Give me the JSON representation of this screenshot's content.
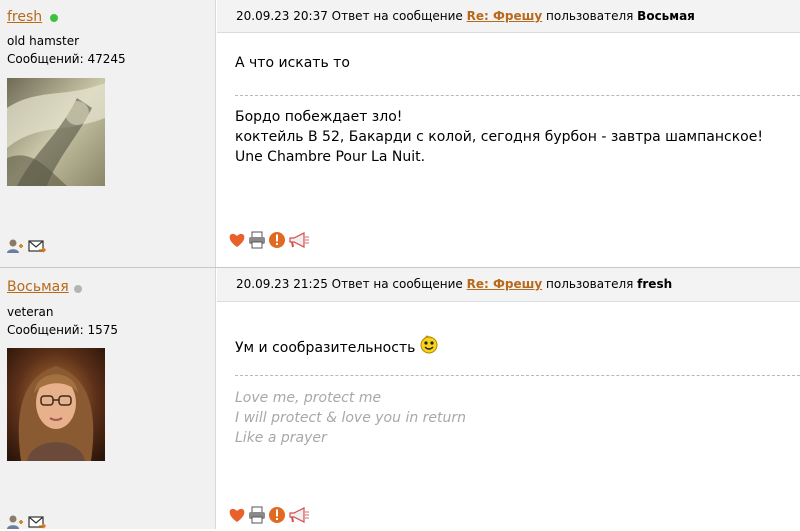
{
  "posts": [
    {
      "user": {
        "name": "fresh",
        "online": true,
        "rank": "old hamster",
        "posts": "Сообщений: 47245"
      },
      "header": {
        "datetime": "20.09.23 20:37",
        "reply_text": "Ответ на сообщение",
        "reply_link": "Re: Фрешу",
        "by_text": "пользователя",
        "reply_user": "Восьмая"
      },
      "message": "А что искать то",
      "signature": [
        "Бордо побеждает зло!",
        "коктейль В 52, Бакарди с колой, сегодня бурбон - завтра шампанское!",
        "Une Chambre Pour La Nuit."
      ]
    },
    {
      "user": {
        "name": "Восьмая",
        "online": false,
        "rank": "veteran",
        "posts": "Сообщений: 1575"
      },
      "header": {
        "datetime": "20.09.23 21:25",
        "reply_text": "Ответ на сообщение",
        "reply_link": "Re: Фрешу",
        "by_text": "пользователя",
        "reply_user": "fresh"
      },
      "message": "Ум и сообразительность",
      "signature": [
        "Love me, protect me",
        "I will protect & love you in return",
        "Like a prayer"
      ]
    }
  ],
  "icons": {
    "user_actions": [
      "add-friend-icon",
      "send-message-icon"
    ],
    "post_actions": [
      "like-heart-icon",
      "print-icon",
      "report-icon",
      "megaphone-icon"
    ],
    "emoticon": "smiley-icon"
  },
  "colors": {
    "link": "#b8691b",
    "online": "#3cc33c",
    "offline": "#b4b4b4",
    "sidebar": "#f1f1f1",
    "signature_italic": "#a8a8a8"
  }
}
